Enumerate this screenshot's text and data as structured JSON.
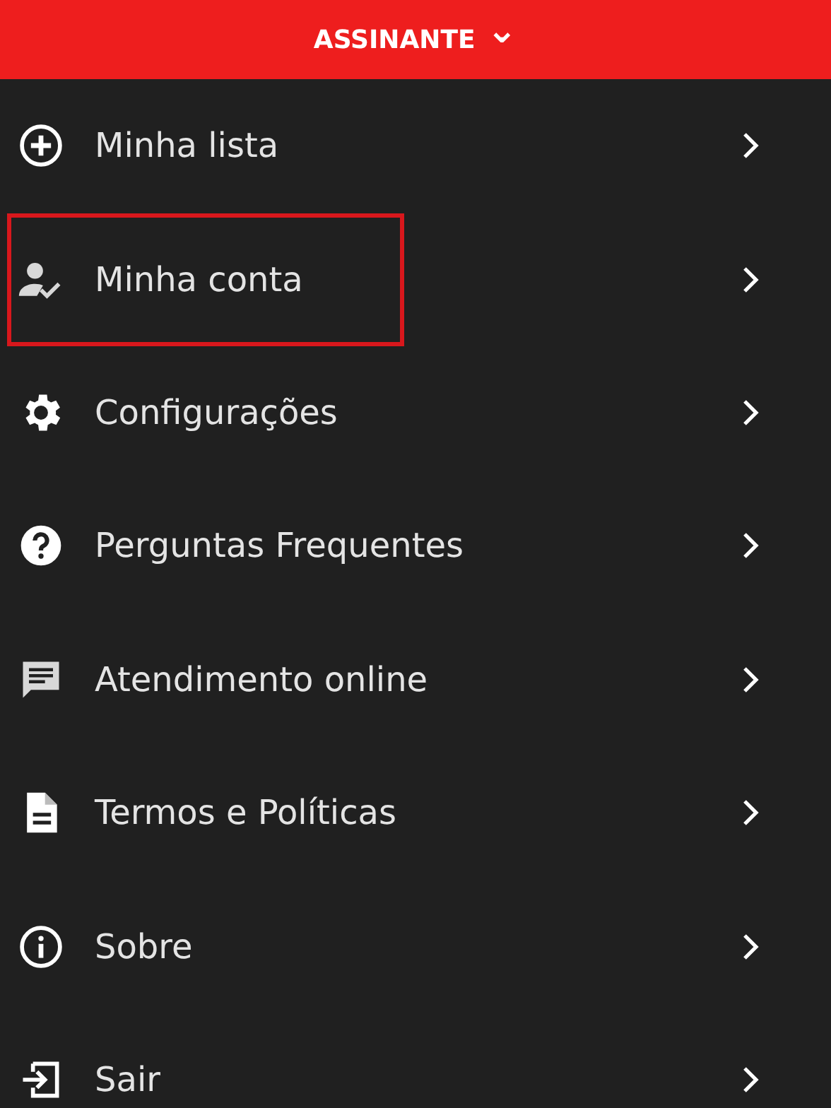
{
  "header": {
    "label": "ASSINANTE",
    "chevron": "⌄"
  },
  "menu": [
    {
      "kind": "add",
      "label": "Minha lista",
      "highlighted": false
    },
    {
      "kind": "account",
      "label": "Minha conta",
      "highlighted": true
    },
    {
      "kind": "settings",
      "label": "Configurações",
      "highlighted": false
    },
    {
      "kind": "help",
      "label": "Perguntas Frequentes",
      "highlighted": false
    },
    {
      "kind": "chat",
      "label": "Atendimento online",
      "highlighted": false
    },
    {
      "kind": "document",
      "label": "Termos e Políticas",
      "highlighted": false
    },
    {
      "kind": "info",
      "label": "Sobre",
      "highlighted": false
    },
    {
      "kind": "exit",
      "label": "Sair",
      "highlighted": false
    }
  ]
}
